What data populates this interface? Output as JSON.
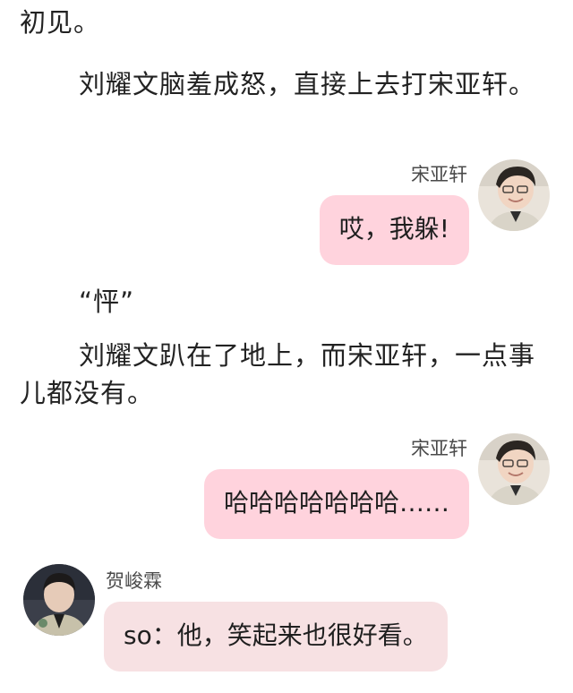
{
  "story": {
    "line_1": "初见。",
    "para_2": "刘耀文脑羞成怒，直接上去打宋亚轩。",
    "sound": "“怦”",
    "para_4": "刘耀文趴在了地上，而宋亚轩，一点事儿都没有。"
  },
  "chat": [
    {
      "side": "right",
      "name": "宋亚轩",
      "text": "哎，我躲!"
    },
    {
      "side": "right",
      "name": "宋亚轩",
      "text": "哈哈哈哈哈哈哈……"
    },
    {
      "side": "left",
      "name": "贺峻霖",
      "text": "so：他，笑起来也很好看。"
    }
  ],
  "colors": {
    "right_bubble": "#ffd3dd",
    "left_bubble": "#f7e1e3",
    "text": "#222222",
    "name": "#4a4a4a"
  },
  "icons": {
    "avatar_right": "person-avatar-icon",
    "avatar_left": "person-avatar-icon"
  }
}
